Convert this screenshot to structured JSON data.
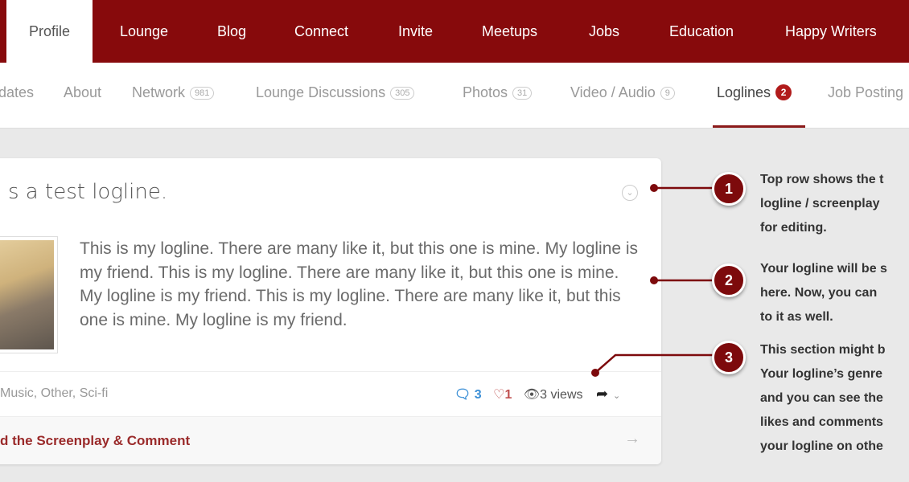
{
  "top_nav": {
    "items": [
      "Profile",
      "Lounge",
      "Blog",
      "Connect",
      "Invite",
      "Meetups",
      "Jobs",
      "Education",
      "Happy Writers"
    ],
    "active": "Profile"
  },
  "sub_nav": {
    "tabs": [
      {
        "label": "dates"
      },
      {
        "label": "About"
      },
      {
        "label": "Network",
        "count": "981"
      },
      {
        "label": "Lounge Discussions",
        "count": "305"
      },
      {
        "label": "Photos",
        "count": "31"
      },
      {
        "label": "Video / Audio",
        "count": "9"
      },
      {
        "label": "Loglines",
        "badge": "2"
      },
      {
        "label": "Job Posting"
      }
    ],
    "active": "Loglines"
  },
  "logline": {
    "title": "s a test logline.",
    "body": "This is my logline. There are many like it, but this one is mine. My logline is my friend. This is my logline. There are many like it, but this one is mine. My logline is my friend. This is my logline. There are many like it, but this one is mine. My logline is my friend.",
    "genres": "Music, Other, Sci-fi",
    "comments": "3",
    "likes": "1",
    "views": "3 views",
    "read_link": "d the Screenplay & Comment"
  },
  "callouts": [
    {
      "number": "1",
      "lines": [
        "Top row shows the t",
        "logline / screenplay",
        "for editing."
      ]
    },
    {
      "number": "2",
      "lines": [
        "Your logline will be s",
        "here.  Now, you can",
        "to it as well."
      ]
    },
    {
      "number": "3",
      "lines": [
        "This section might b",
        "Your logline’s genre",
        "and you can see the",
        "likes and comments",
        "your logline on othe"
      ]
    }
  ],
  "colors": {
    "brand": "#870a0c",
    "comment": "#3b8fd6",
    "like": "#c05050"
  }
}
